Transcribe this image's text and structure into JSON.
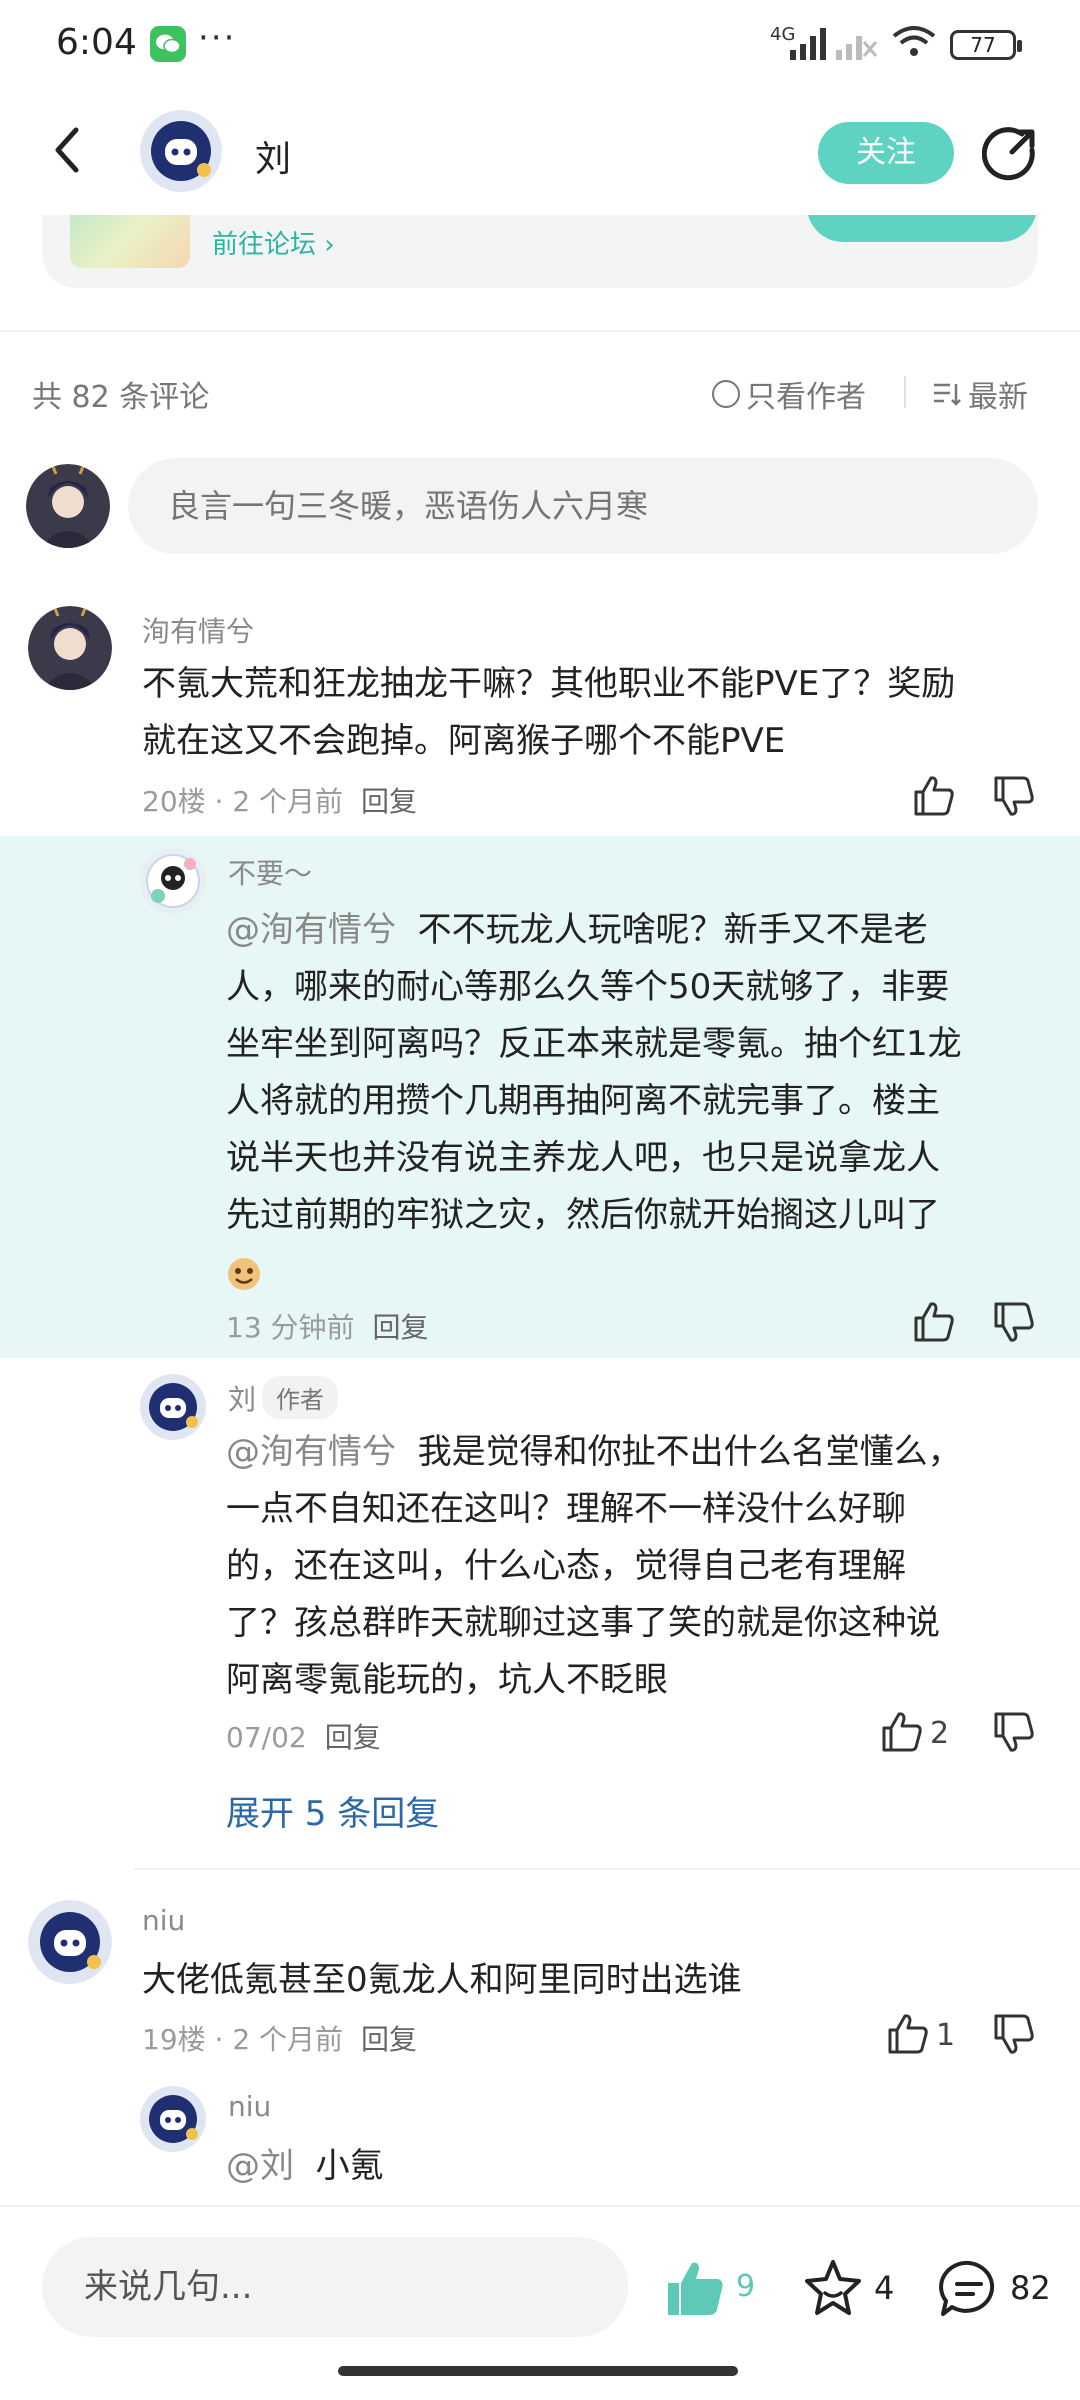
{
  "status_bar": {
    "time": "6:04",
    "dots": "···",
    "battery": "77",
    "network": "4G"
  },
  "header": {
    "username": "刘",
    "follow_label": "关注"
  },
  "forum_card": {
    "goto_label": "前往论坛"
  },
  "comments_bar": {
    "count_label": "共 82 条评论",
    "only_author_label": "只看作者",
    "sort_label": "最新"
  },
  "comment_input": {
    "placeholder": "良言一句三冬暖，恶语伤人六月寒"
  },
  "comments": [
    {
      "user": "洵有情兮",
      "text": "不氪大荒和狂龙抽龙干嘛？其他职业不能PVE了？奖励就在这又不会跑掉。阿离猴子哪个不能PVE",
      "text_line1": "不氪大荒和狂龙抽龙干嘛？其他职业不能PVE了？奖励",
      "text_line2": "就在这又不会跑掉。阿离猴子哪个不能PVE",
      "meta": "20楼 · 2 个月前",
      "reply_label": "回复"
    },
    {
      "user": "不要～",
      "mention": "@洵有情兮",
      "text_lines": [
        "不不玩龙人玩啥呢？新手又不是老",
        "人，哪来的耐心等那么久等个50天就够了，非要",
        "坐牢坐到阿离吗？反正本来就是零氪。抽个红1龙",
        "人将就的用攒个几期再抽阿离不就完事了。楼主",
        "说半天也并没有说主养龙人吧，也只是说拿龙人",
        "先过前期的牢狱之灾，然后你就开始搁这儿叫了"
      ],
      "meta": "13 分钟前",
      "reply_label": "回复"
    },
    {
      "user": "刘",
      "tag": "作者",
      "mention": "@洵有情兮",
      "text_lines": [
        "我是觉得和你扯不出什么名堂懂么，",
        "一点不自知还在这叫？理解不一样没什么好聊",
        "的，还在这叫，什么心态，觉得自己老有理解",
        "了？孩总群昨天就聊过这事了笑的就是你这种说",
        "阿离零氪能玩的，坑人不眨眼"
      ],
      "meta": "07/02",
      "reply_label": "回复",
      "likes": "2"
    },
    {
      "expand_label": "展开 5 条回复"
    },
    {
      "user": "niu",
      "text": "大佬低氪甚至0氪龙人和阿里同时出选谁",
      "meta": "19楼 · 2 个月前",
      "reply_label": "回复",
      "likes": "1"
    },
    {
      "user": "niu",
      "mention": "@刘",
      "text": "小氪"
    }
  ],
  "bottom_bar": {
    "say_label": "来说几句...",
    "likes": "9",
    "favorites": "4",
    "comments": "82"
  },
  "colors": {
    "accent": "#5fd3c2",
    "highlight_bg": "#e6f7f5",
    "link": "#2a68a8"
  }
}
